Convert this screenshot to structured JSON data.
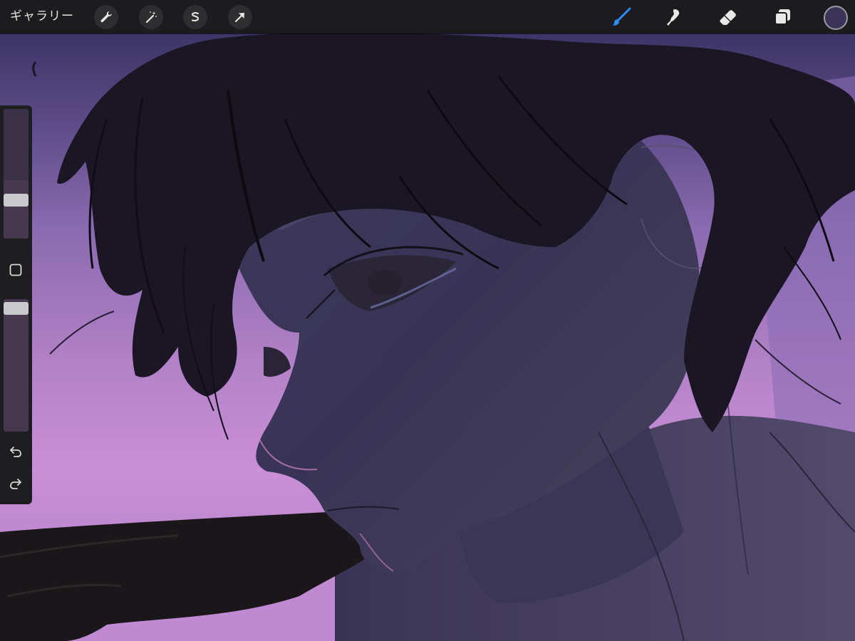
{
  "toolbar": {
    "gallery_label": "ギャラリー",
    "left_tools": [
      "wrench-icon",
      "magic-wand-icon",
      "selection-s-icon",
      "move-arrow-icon"
    ],
    "right_tools": [
      "brush-icon",
      "smudge-icon",
      "eraser-icon",
      "layers-icon"
    ],
    "active_tool": "brush-icon",
    "active_tool_color": "#2f8cff",
    "current_color": "#3b3458"
  },
  "sidebar": {
    "brush_size_level": 0.72,
    "brush_opacity_level": 1.0,
    "buttons": [
      "modify-square-icon",
      "undo-icon",
      "redo-icon"
    ]
  },
  "canvas": {
    "palette": {
      "sky_top": "#3d3567",
      "sky_bottom": "#c98fd8",
      "skin_shadow": "#393556",
      "hair": "#1b1624",
      "dark_foreground": "#1b1619"
    }
  }
}
